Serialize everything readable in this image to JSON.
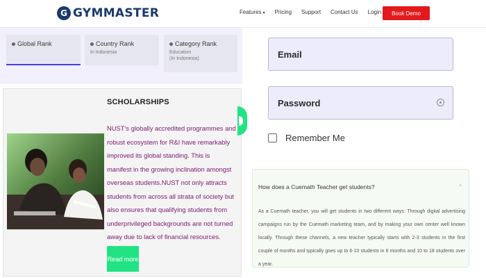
{
  "header": {
    "logo_mark": "G",
    "logo_text": "GYMMASTER",
    "nav": [
      {
        "label": "Features",
        "has_caret": true
      },
      {
        "label": "Pricing"
      },
      {
        "label": "Support"
      },
      {
        "label": "Contact Us"
      },
      {
        "label": "Login"
      }
    ],
    "cta_label": "Book Demo",
    "cta_color": "#e3191b"
  },
  "rank_tabs": [
    {
      "title": "Global Rank",
      "sub": "",
      "active": true
    },
    {
      "title": "Country Rank",
      "sub": "In Indonesia"
    },
    {
      "title": "Category Rank",
      "sub": "Education",
      "sub2": "(In Indonesia)"
    }
  ],
  "scholarship": {
    "title": "SCHOLARSHIPS",
    "body": "NUST's globally accredited programmes and robust ecosystem for R&I have remarkably improved its global standing. This is manifest in the growing inclination amongst overseas students.NUST not only attracts students from across all strata of society but also ensures that qualifying students from underprivileged backgrounds are not turned away due to lack of financial resources.",
    "button": "Read more",
    "accent": "#22e384",
    "text_color": "#7a1a6e"
  },
  "login": {
    "email_label": "Email",
    "password_label": "Password",
    "remember_label": "Remember Me"
  },
  "faq": {
    "question": "How does a Cuemath Teacher get students?",
    "answer": "As a Cuemath teacher, you will get students in two different ways: Through digital advertising campaigns run by the Cuemath marketing team, and by making your own center well known locally. Through these channels, a new teacher typically starts with 2-3 students in the first couple of months and typically goes up to 6-10 students in 6 months and 10 to 18 students over a year."
  }
}
